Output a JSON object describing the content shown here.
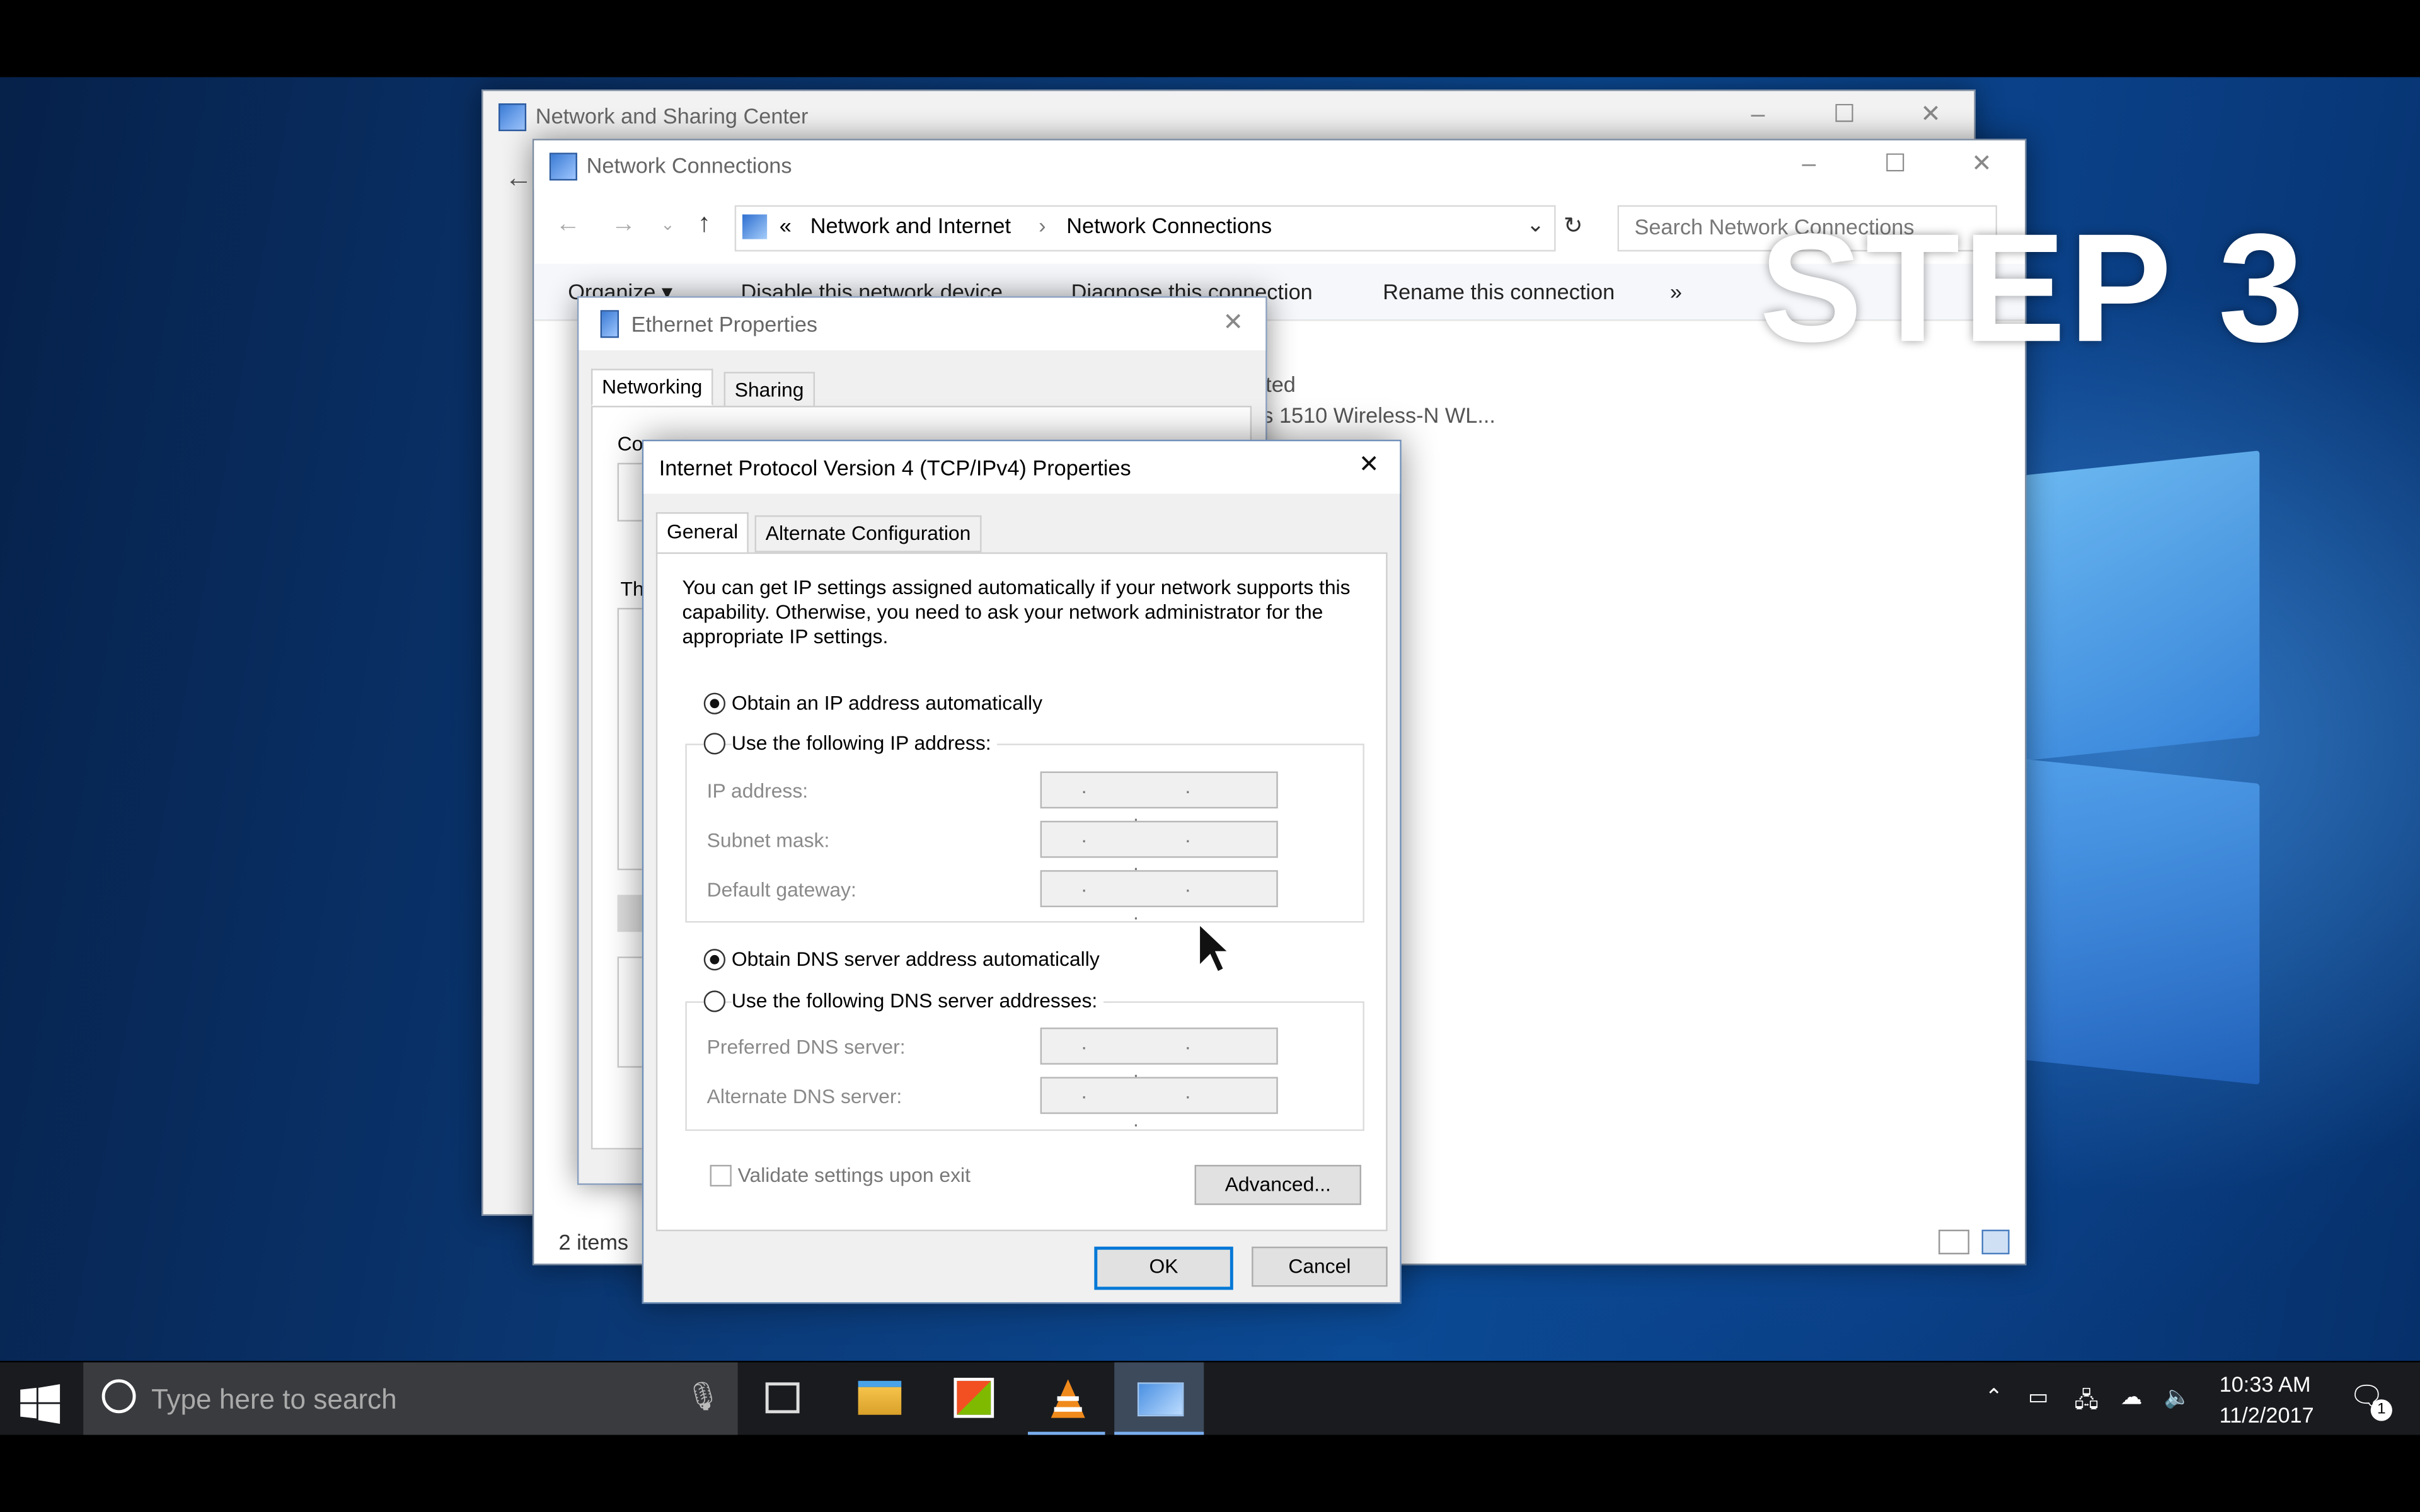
{
  "overlay": {
    "step_text": "STEP 3"
  },
  "nsc_window": {
    "title": "Network and Sharing Center"
  },
  "nc_window": {
    "title": "Network Connections",
    "breadcrumb_prefix": "«",
    "breadcrumb_1": "Network and Internet",
    "breadcrumb_sep": "›",
    "breadcrumb_2": "Network Connections",
    "search_placeholder": "Search Network Connections",
    "toolbar": {
      "organize": "Organize ▾",
      "disable": "Disable this network device",
      "diagnose": "Diagnose this connection",
      "rename": "Rename this connection",
      "more": "»"
    },
    "item_status_fragment": "ted",
    "item_adapter_fragment": "s 1510 Wireless-N WL...",
    "status_bar": "2 items"
  },
  "eth_window": {
    "title": "Ethernet Properties",
    "tabs": [
      "Networking",
      "Sharing"
    ],
    "connect_fragment": "Co",
    "this_fragment": "Th"
  },
  "ipv4_dialog": {
    "title": "Internet Protocol Version 4 (TCP/IPv4) Properties",
    "tabs": [
      "General",
      "Alternate Configuration"
    ],
    "description": "You can get IP settings assigned automatically if your network supports this capability. Otherwise, you need to ask your network administrator for the appropriate IP settings.",
    "ip_auto": "Obtain an IP address automatically",
    "ip_manual": "Use the following IP address:",
    "ip_label": "IP address:",
    "subnet_label": "Subnet mask:",
    "gateway_label": "Default gateway:",
    "dns_auto": "Obtain DNS server address automatically",
    "dns_manual": "Use the following DNS server addresses:",
    "preferred_dns_label": "Preferred DNS server:",
    "alternate_dns_label": "Alternate DNS server:",
    "ip_placeholder": ". . .",
    "validate": "Validate settings upon exit",
    "advanced": "Advanced...",
    "ok": "OK",
    "cancel": "Cancel"
  },
  "taskbar": {
    "search_placeholder": "Type here to search",
    "time": "10:33 AM",
    "date": "11/2/2017",
    "notification_count": "1"
  }
}
